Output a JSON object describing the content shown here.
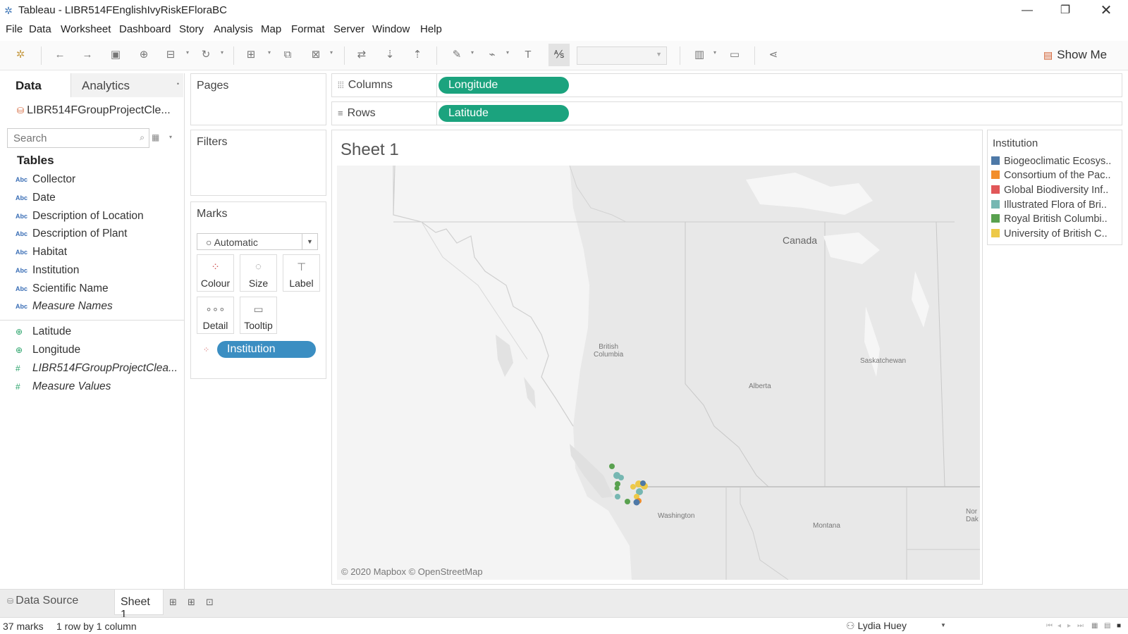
{
  "window": {
    "title": "Tableau - LIBR514FEnglishIvyRiskEFloraBC"
  },
  "menu": [
    "File",
    "Data",
    "Worksheet",
    "Dashboard",
    "Story",
    "Analysis",
    "Map",
    "Format",
    "Server",
    "Window",
    "Help"
  ],
  "toolbar": {
    "show_me": "Show Me"
  },
  "data_pane": {
    "tab_data": "Data",
    "tab_analytics": "Analytics",
    "data_source": "LIBR514FGroupProjectCle...",
    "search_placeholder": "Search",
    "tables_header": "Tables",
    "dimensions": [
      {
        "type": "Abc",
        "name": "Collector"
      },
      {
        "type": "Abc",
        "name": "Date"
      },
      {
        "type": "Abc",
        "name": "Description of Location"
      },
      {
        "type": "Abc",
        "name": "Description of Plant"
      },
      {
        "type": "Abc",
        "name": "Habitat"
      },
      {
        "type": "Abc",
        "name": "Institution"
      },
      {
        "type": "Abc",
        "name": "Scientific Name"
      },
      {
        "type": "Abc",
        "name": "Measure Names"
      }
    ],
    "measures": [
      {
        "type": "globe",
        "name": "Latitude"
      },
      {
        "type": "globe",
        "name": "Longitude"
      },
      {
        "type": "#",
        "name": "LIBR514FGroupProjectClea..."
      },
      {
        "type": "#",
        "name": "Measure Values"
      }
    ]
  },
  "cards": {
    "pages": "Pages",
    "filters": "Filters",
    "marks": "Marks",
    "mark_type": "Automatic",
    "buttons": [
      "Colour",
      "Size",
      "Label",
      "Detail",
      "Tooltip"
    ],
    "colour_pill": "Institution"
  },
  "shelves": {
    "columns_label": "Columns",
    "columns_pill": "Longitude",
    "rows_label": "Rows",
    "rows_pill": "Latitude"
  },
  "view": {
    "sheet_title": "Sheet 1",
    "map_labels": {
      "canada": "Canada",
      "british_columbia": "British\nColumbia",
      "alberta": "Alberta",
      "saskatchewan": "Saskatchewan",
      "washington": "Washington",
      "montana": "Montana",
      "north_dakota": "Nor\nDak"
    },
    "copyright": "© 2020 Mapbox © OpenStreetMap"
  },
  "legend": {
    "title": "Institution",
    "items": [
      {
        "label": "Biogeoclimatic Ecosys..",
        "color": "#4e79a7"
      },
      {
        "label": "Consortium of the Pac..",
        "color": "#f28e2b"
      },
      {
        "label": "Global Biodiversity Inf..",
        "color": "#e15759"
      },
      {
        "label": "Illustrated Flora of Bri..",
        "color": "#76b7b2"
      },
      {
        "label": "Royal British Columbi..",
        "color": "#59a14f"
      },
      {
        "label": "University of British C..",
        "color": "#edc948"
      }
    ]
  },
  "bottom": {
    "data_source_tab": "Data Source",
    "sheet_tab": "Sheet 1",
    "marks_count": "37 marks",
    "dims": "1 row by 1 column",
    "user": "Lydia Huey"
  }
}
